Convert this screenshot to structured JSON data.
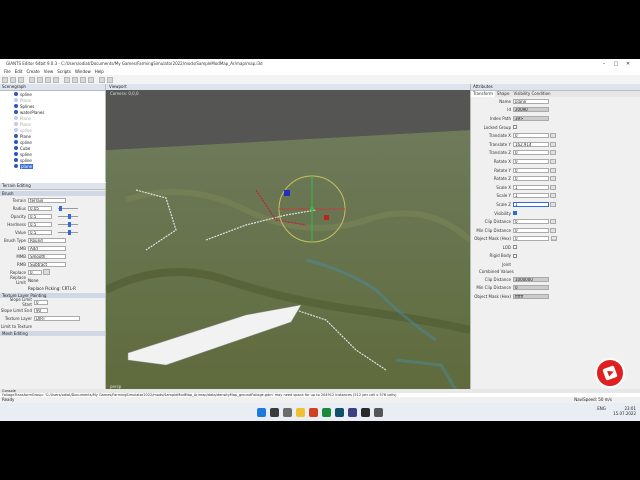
{
  "window": {
    "title": "GIANTS Editor 64bit 9.0.3 - C:/Users/odiat/Documents/My Games/FarmingSimulator2022/mods/SampleModMap_Ar/map/map.i3d",
    "controls": [
      "–",
      "□",
      "✕"
    ]
  },
  "menu": [
    "File",
    "Edit",
    "Create",
    "View",
    "Scripts",
    "Window",
    "Help"
  ],
  "scenegraph": {
    "title": "Scenegraph",
    "items": [
      {
        "label": "spline",
        "state": "normal"
      },
      {
        "label": "Plane",
        "state": "dim"
      },
      {
        "label": "Splines",
        "state": "normal"
      },
      {
        "label": "waterPlanes",
        "state": "normal"
      },
      {
        "label": "Plane",
        "state": "dim"
      },
      {
        "label": "Plane",
        "state": "dim"
      },
      {
        "label": "spline",
        "state": "dim"
      },
      {
        "label": "Plane",
        "state": "normal"
      },
      {
        "label": "spline",
        "state": "normal"
      },
      {
        "label": "Cube",
        "state": "normal"
      },
      {
        "label": "spline",
        "state": "normal"
      },
      {
        "label": "spline",
        "state": "normal"
      },
      {
        "label": "plane",
        "state": "selected"
      }
    ]
  },
  "terrain_editing": {
    "title": "Terrain Editing",
    "brush_header": "Brush",
    "terrain_label": "Terrain",
    "terrain_value": "terrain",
    "radius_label": "Radius",
    "radius_value": "0.05",
    "opacity_label": "Opacity",
    "opacity_value": "0.5",
    "hardness_label": "Hardness",
    "hardness_value": "0.5",
    "value_label": "Value",
    "value_value": "0.5",
    "brush_type_label": "Brush Type",
    "brush_type_value": "Round",
    "lmb_label": "LMB",
    "lmb_value": "Add",
    "mmb_label": "MMB",
    "mmb_value": "Smooth",
    "rmb_label": "RMB",
    "rmb_value": "Subtract",
    "replace_label": "Replace",
    "replace_value": "0, 0.5",
    "replace_limit_label": "Replace Limit",
    "replace_limit_value": "None",
    "replace_picking": "Replace Picking: CRTL-R",
    "texture_header": "Texture Layer Painting",
    "slope_start_label": "Slope Limit Start",
    "slope_start_value": "0",
    "slope_end_label": "Slope Limit End",
    "slope_end_value": "90",
    "texture_layer_label": "Texture Layer",
    "texture_layer_value": "DIRT",
    "limit_texture_label": "Limit to Texture",
    "mesh_header": "Mesh Editing"
  },
  "viewport": {
    "title": "Viewport",
    "overlay": "Camera: 0,0,0",
    "footer": "persp"
  },
  "attributes": {
    "title": "Attributes",
    "tabs": [
      "Transform",
      "Shape",
      "Visibility Condition"
    ],
    "name_label": "Name",
    "name_value": "plane",
    "id_label": "Id",
    "id_value": "20090",
    "index_label": "Index Path",
    "index_value": "39>",
    "locked_label": "Locked Group",
    "tx_label": "Translate X",
    "tx_value": "0",
    "ty_label": "Translate Y",
    "ty_value": "162.914",
    "tz_label": "Translate Z",
    "tz_value": "0",
    "rx_label": "Rotate X",
    "rx_value": "0",
    "ry_label": "Rotate Y",
    "ry_value": "0",
    "rz_label": "Rotate Z",
    "rz_value": "0",
    "sx_label": "Scale X",
    "sx_value": "1",
    "sy_label": "Scale Y",
    "sy_value": "1",
    "sz_label": "Scale Z",
    "sz_value": "1",
    "visibility_label": "Visibility",
    "clip_label": "Clip Distance",
    "clip_value": "0",
    "min_clip_label": "Min Clip Distance",
    "min_clip_value": "0",
    "obj_mask_label": "Object Mask (Hex)",
    "obj_mask_value": "0",
    "lod_label": "LOD",
    "rigid_label": "Rigid Body",
    "joint_label": "Joint",
    "combined_header": "Combined Values",
    "c_clip_label": "Clip Distance",
    "c_clip_value": "1000000",
    "c_min_clip_label": "Min Clip Distance",
    "c_min_clip_value": "0",
    "c_obj_mask_label": "Object Mask (Hex)",
    "c_obj_mask_value": "ffffff"
  },
  "console": {
    "title": "Console",
    "lines": [
      "FoliageTransformGroup: 'C:/Users/odiat/Documents/My Games/FarmingSimulator2022/mods/SampleModMap_Ar/map/data/densityMap_groundFoliage.gdm' may need space for up to 204912 instances (512 per cell x 576 cells)",
      "Started 2 threads for threadpool \"TerrainPatchOcclusionManager threadpool\""
    ]
  },
  "status": {
    "left": "Ready",
    "right": "NaviSpeed: 50 m/s"
  },
  "taskbar": {
    "lang": "ENG",
    "time": "23:01",
    "date": "15.07.2022"
  },
  "colors": {
    "accent": "#2b6cd8",
    "terrain": "#6d7a45",
    "record_badge": "#e02020"
  }
}
